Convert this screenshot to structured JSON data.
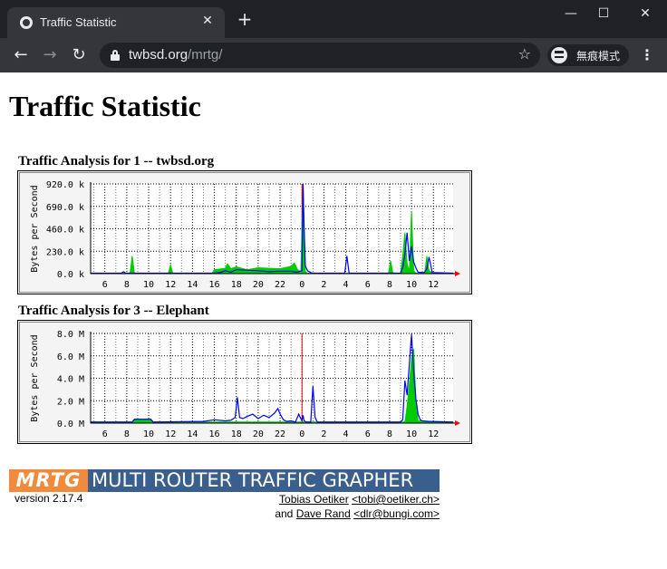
{
  "browser": {
    "tab_title": "Traffic Statistic",
    "url_host": "twbsd.org",
    "url_path": "/mrtg/",
    "incognito_label": "無痕模式",
    "icons": {
      "favicon": "globe-icon",
      "close": "close-icon",
      "new_tab": "plus-icon",
      "back": "arrow-left-icon",
      "forward": "arrow-right-icon",
      "reload": "reload-icon",
      "lock": "lock-icon",
      "bookmark": "star-icon",
      "incognito": "incognito-icon",
      "menu": "kebab-menu-icon",
      "minimize": "minimize-icon",
      "maximize": "maximize-icon",
      "close_window": "close-window-icon"
    }
  },
  "page": {
    "title": "Traffic Statistic"
  },
  "graphs": [
    {
      "heading": "Traffic Analysis for 1 -- twbsd.org",
      "chart_data": {
        "type": "area",
        "ylabel": "Bytes per Second",
        "yticks": [
          "920.0 k",
          "690.0 k",
          "460.0 k",
          "230.0 k",
          "0.0 k"
        ],
        "ylim": [
          0,
          920
        ],
        "y_unit": "k",
        "xticks": [
          "6",
          "8",
          "10",
          "12",
          "14",
          "16",
          "18",
          "20",
          "22",
          "0",
          "2",
          "4",
          "6",
          "8",
          "10",
          "12"
        ],
        "x_range_hours": [
          4.7,
          37.8
        ],
        "grid": true,
        "series": [
          {
            "color": "#00cc00",
            "x": [
              4.7,
              8.3,
              8.5,
              8.7,
              11.8,
              12.0,
              12.2,
              15.8,
              16.0,
              17.0,
              17.2,
              17.5,
              18.0,
              19.0,
              20.0,
              21.0,
              22.0,
              23.0,
              23.3,
              23.6,
              23.9,
              24.1,
              24.3,
              24.5,
              25.0,
              31.9,
              32.1,
              32.3,
              33.0,
              33.2,
              33.4,
              33.6,
              33.8,
              34.0,
              34.2,
              34.4,
              34.6,
              34.8,
              35.0,
              35.2,
              35.4,
              35.6,
              35.9,
              36.1,
              36.3,
              37.8
            ],
            "values": [
              5,
              5,
              180,
              5,
              5,
              90,
              5,
              5,
              40,
              55,
              100,
              50,
              70,
              40,
              60,
              55,
              50,
              75,
              110,
              40,
              20,
              920,
              20,
              5,
              5,
              5,
              130,
              5,
              5,
              180,
              420,
              100,
              20,
              640,
              30,
              5,
              5,
              5,
              5,
              5,
              180,
              30,
              10,
              5,
              5,
              5
            ]
          },
          {
            "color": "#0000ff",
            "x": [
              4.7,
              7.5,
              7.7,
              7.9,
              16.0,
              16.5,
              17.0,
              17.5,
              18.0,
              20.0,
              21.0,
              22.0,
              23.0,
              23.5,
              24.0,
              24.1,
              24.2,
              24.3,
              24.5,
              24.8,
              25.0,
              27.9,
              28.1,
              28.3,
              32.0,
              33.0,
              33.2,
              33.4,
              33.6,
              33.8,
              34.0,
              34.2,
              34.4,
              34.6,
              35.0,
              35.2,
              35.4,
              35.6,
              35.9,
              37.8
            ],
            "values": [
              5,
              5,
              20,
              5,
              5,
              10,
              30,
              15,
              40,
              30,
              20,
              25,
              25,
              15,
              30,
              920,
              460,
              80,
              30,
              10,
              5,
              5,
              180,
              5,
              5,
              5,
              60,
              200,
              420,
              130,
              280,
              120,
              60,
              15,
              10,
              15,
              50,
              170,
              10,
              5
            ]
          }
        ]
      }
    },
    {
      "heading": "Traffic Analysis for 3 -- Elephant",
      "chart_data": {
        "type": "area",
        "ylabel": "Bytes per Second",
        "yticks": [
          "8.0 M",
          "6.0 M",
          "4.0 M",
          "2.0 M",
          "0.0 M"
        ],
        "ylim": [
          0,
          8
        ],
        "y_unit": "M",
        "xticks": [
          "6",
          "8",
          "10",
          "12",
          "14",
          "16",
          "18",
          "20",
          "22",
          "0",
          "2",
          "4",
          "6",
          "8",
          "10",
          "12"
        ],
        "x_range_hours": [
          4.7,
          37.8
        ],
        "grid": true,
        "series": [
          {
            "color": "#00cc00",
            "x": [
              4.7,
              8.5,
              8.7,
              10.2,
              10.4,
              33.4,
              33.6,
              33.8,
              34.0,
              34.2,
              34.4,
              34.6,
              37.8
            ],
            "values": [
              0.1,
              0.1,
              0.35,
              0.35,
              0.1,
              0.1,
              1.5,
              3.5,
              5.8,
              6.6,
              2.0,
              0.2,
              0.1
            ]
          },
          {
            "color": "#0000ff",
            "x": [
              4.7,
              8.5,
              8.7,
              10.2,
              10.4,
              15.0,
              16.0,
              17.0,
              17.5,
              17.9,
              18.1,
              18.3,
              18.6,
              19.0,
              19.5,
              20.0,
              20.5,
              21.0,
              21.5,
              21.8,
              22.0,
              22.3,
              22.6,
              23.0,
              23.4,
              23.7,
              24.0,
              24.1,
              24.2,
              24.4,
              24.8,
              25.0,
              25.2,
              25.4,
              25.6,
              26.0,
              33.0,
              33.2,
              33.4,
              33.6,
              33.8,
              34.0,
              34.2,
              34.4,
              34.6,
              34.8,
              35.0,
              35.5,
              37.8
            ],
            "values": [
              0.1,
              0.1,
              0.35,
              0.35,
              0.1,
              0.15,
              0.3,
              0.2,
              0.25,
              0.5,
              2.3,
              0.5,
              0.4,
              0.6,
              0.8,
              0.4,
              0.7,
              0.5,
              0.9,
              1.3,
              0.8,
              0.3,
              0.15,
              0.2,
              0.1,
              0.8,
              0.2,
              0.7,
              0.2,
              0.1,
              0.1,
              3.3,
              0.5,
              0.1,
              0.1,
              0.1,
              0.1,
              0.3,
              3.8,
              2.5,
              5.3,
              7.9,
              4.5,
              2.2,
              0.8,
              0.3,
              0.2,
              0.15,
              0.1
            ]
          }
        ]
      }
    }
  ],
  "footer": {
    "logo_mark": "MRTG",
    "logo_text": "MULTI ROUTER TRAFFIC GRAPHER",
    "version": "version 2.17.4",
    "author1_name": "Tobias Oetiker",
    "author1_email": "<tobi@oetiker.ch>",
    "and": "and",
    "author2_name": "Dave Rand",
    "author2_email": "<dlr@bungi.com>"
  }
}
